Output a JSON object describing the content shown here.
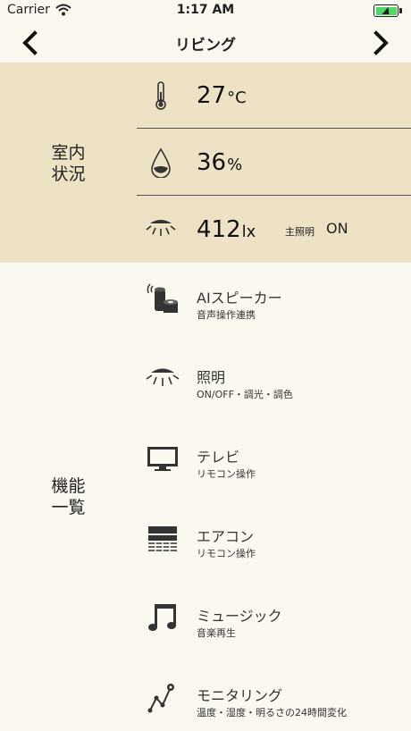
{
  "status_bar": {
    "carrier": "Carrier",
    "time": "1:17 AM",
    "battery_color": "#4cd964"
  },
  "nav": {
    "title": "リビング"
  },
  "room_status": {
    "label": "室内\n状況",
    "temperature": {
      "value": "27",
      "unit": "°C",
      "icon": "thermometer-icon"
    },
    "humidity": {
      "value": "36",
      "unit": "%",
      "icon": "water-drop-icon"
    },
    "illuminance": {
      "value": "412",
      "unit": "lx",
      "icon": "ceiling-light-icon",
      "main_light_label": "主照明",
      "main_light_state": "ON"
    }
  },
  "functions": {
    "label": "機能\n一覧",
    "items": [
      {
        "title": "AIスピーカー",
        "subtitle": "音声操作連携",
        "icon": "smart-speaker-icon"
      },
      {
        "title": "照明",
        "subtitle": "ON/OFF・調光・調色",
        "icon": "ceiling-light-icon"
      },
      {
        "title": "テレビ",
        "subtitle": "リモコン操作",
        "icon": "tv-icon"
      },
      {
        "title": "エアコン",
        "subtitle": "リモコン操作",
        "icon": "air-conditioner-icon"
      },
      {
        "title": "ミュージック",
        "subtitle": "音楽再生",
        "icon": "music-note-icon"
      },
      {
        "title": "モニタリング",
        "subtitle": "温度・湿度・明るさの24時間変化",
        "icon": "monitoring-chart-icon"
      }
    ]
  },
  "colors": {
    "status_bg": "#ede2c5",
    "page_bg": "#fbf9ef"
  }
}
